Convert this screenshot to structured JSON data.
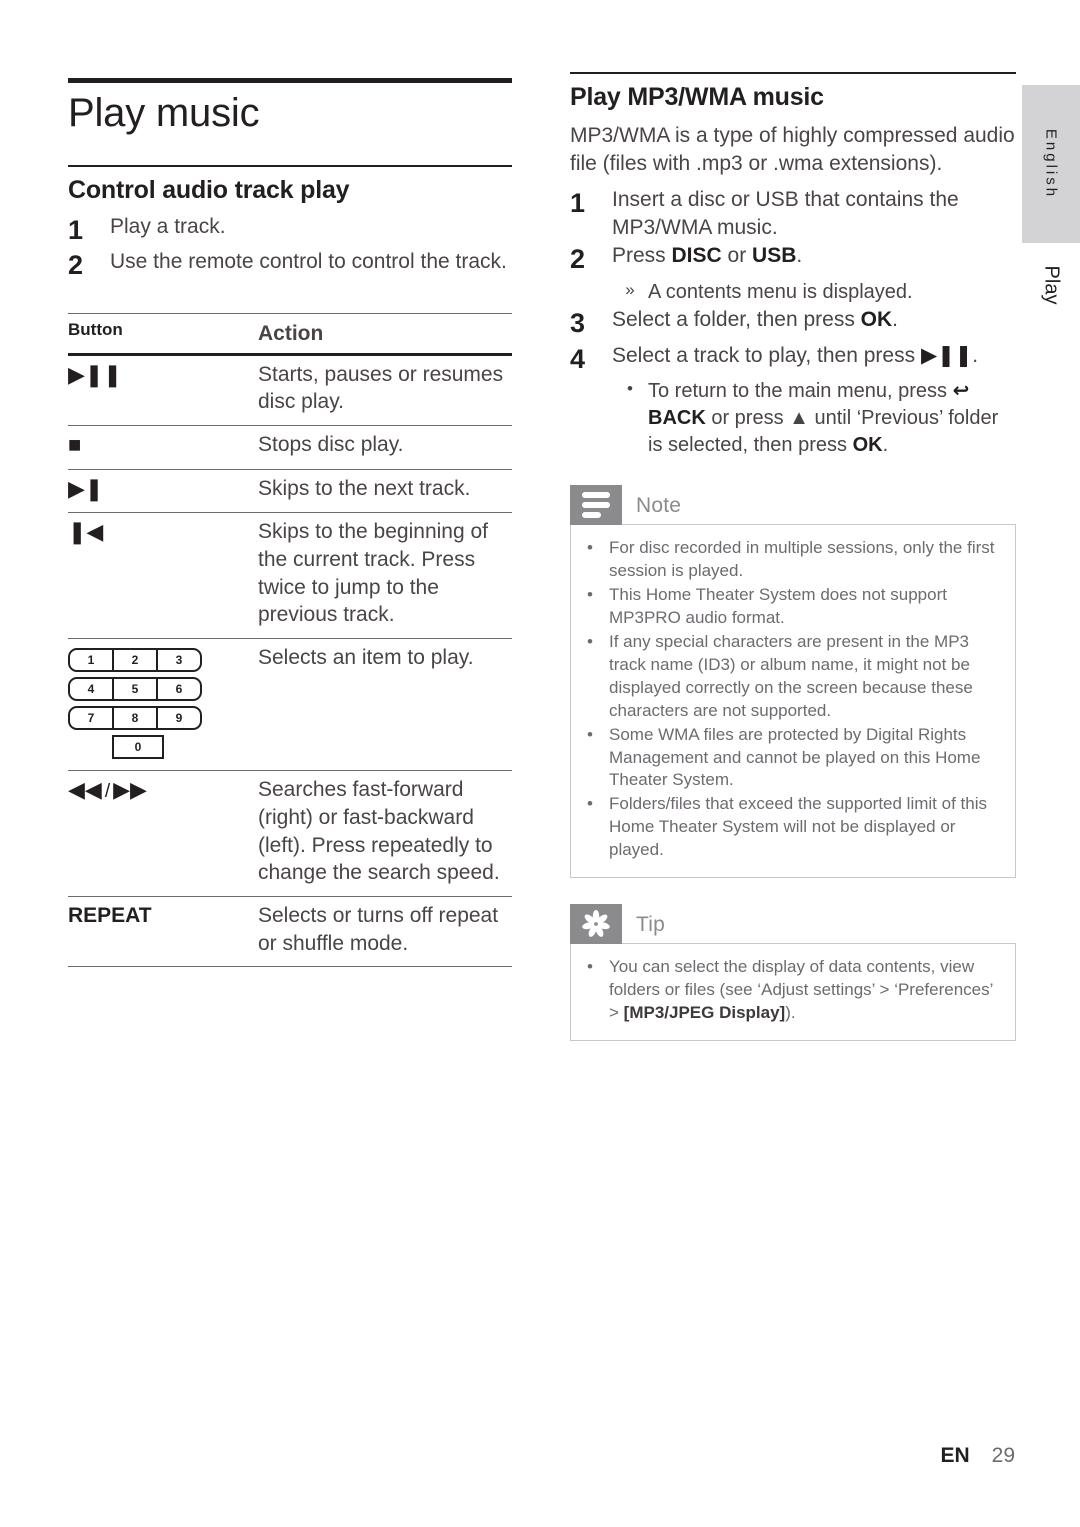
{
  "page": {
    "title": "Play music",
    "footer_lang": "EN",
    "footer_page": "29",
    "side_tab_language": "English",
    "side_tab_section": "Play"
  },
  "left_column": {
    "section_title": "Control audio track play",
    "steps": [
      {
        "num": "1",
        "text": "Play a track."
      },
      {
        "num": "2",
        "text": "Use the remote control to control the track."
      }
    ],
    "table": {
      "header_button": "Button",
      "header_action": "Action",
      "rows": [
        {
          "button_type": "glyph",
          "button_icon": "play-pause-icon",
          "button_glyph": "▶❚❚",
          "action": "Starts, pauses or resumes disc play."
        },
        {
          "button_type": "glyph",
          "button_icon": "stop-icon",
          "button_glyph": "■",
          "action": "Stops disc play."
        },
        {
          "button_type": "glyph",
          "button_icon": "next-track-icon",
          "button_glyph": "▶❚",
          "action": "Skips to the next track."
        },
        {
          "button_type": "glyph",
          "button_icon": "previous-track-icon",
          "button_glyph": "❚◀",
          "action": "Skips to the beginning of the current track. Press twice to jump to the previous track."
        },
        {
          "button_type": "keypad",
          "button_icon": "numeric-keypad-icon",
          "keypad_rows": [
            [
              "1",
              "2",
              "3"
            ],
            [
              "4",
              "5",
              "6"
            ],
            [
              "7",
              "8",
              "9"
            ]
          ],
          "keypad_zero": "0",
          "action": "Selects an item to play."
        },
        {
          "button_type": "glyph",
          "button_icon": "fast-rewind-forward-icon",
          "button_glyph_left": "◀◀",
          "button_glyph_sep": "/",
          "button_glyph_right": "▶▶",
          "action": "Searches fast-forward (right) or fast-backward (left). Press repeatedly to change the search speed."
        },
        {
          "button_type": "keyword",
          "button_icon": "repeat-button",
          "button_label": "REPEAT",
          "action": "Selects or turns off repeat or shuffle mode."
        }
      ]
    }
  },
  "right_column": {
    "section_title": "Play MP3/WMA music",
    "intro": "MP3/WMA is a type of highly compressed audio file (files with .mp3 or .wma extensions).",
    "steps": [
      {
        "num": "1",
        "text_html": "Insert a disc or USB that contains the MP3/WMA music."
      },
      {
        "num": "2",
        "text_html": "Press <b>DISC</b> or <b>USB</b>.",
        "substeps": [
          {
            "mark": "»",
            "text_html": "A contents menu is displayed."
          }
        ]
      },
      {
        "num": "3",
        "text_html": "Select a folder, then press <b>OK</b>."
      },
      {
        "num": "4",
        "text_html": "Select a track to play, then press <b>▶❚❚</b>.",
        "substeps": [
          {
            "mark": "•",
            "text_html": "To return to the main menu, press <b>↩ BACK</b> or press ▲ until ‘Previous’ folder is selected, then press <b>OK</b>."
          }
        ]
      }
    ],
    "note": {
      "icon": "note-icon",
      "label": "Note",
      "items": [
        "For disc recorded in multiple sessions, only the first session is played.",
        "This Home Theater System does not support MP3PRO audio format.",
        "If any special characters are present in the MP3 track name (ID3) or album name, it might not be displayed correctly on the screen because these characters are not supported.",
        "Some WMA files are protected by Digital Rights Management and cannot be played on this Home Theater System.",
        "Folders/files that exceed the supported limit of this Home Theater System will not be displayed or played."
      ]
    },
    "tip": {
      "icon": "tip-icon",
      "label": "Tip",
      "items_html": [
        "You can select the display of data contents, view folders or files (see ‘Adjust settings’ > ‘Preferences’ > <b>[MP3/JPEG Display]</b>)."
      ]
    }
  }
}
